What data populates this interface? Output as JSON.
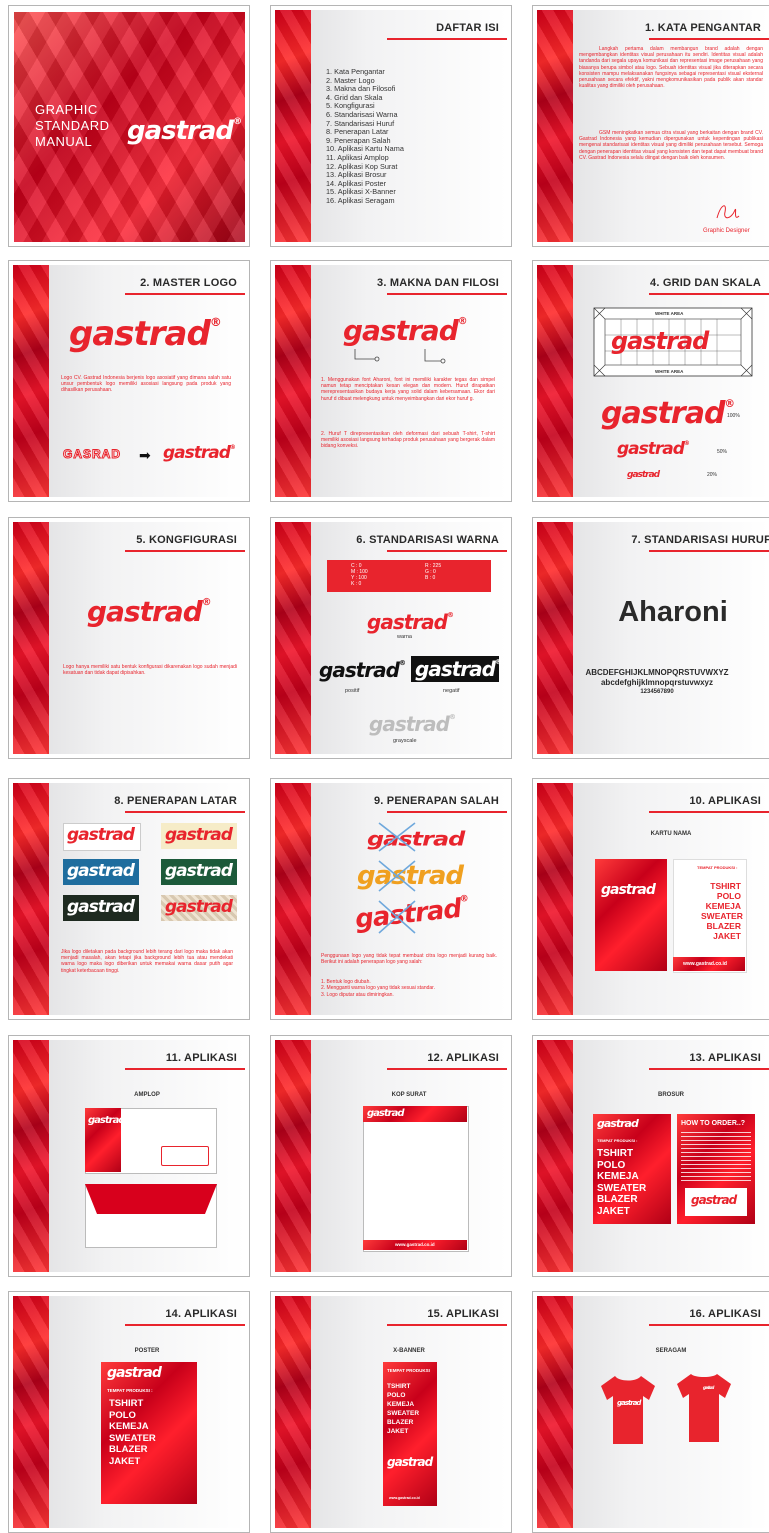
{
  "cover": {
    "line1": "GRAPHIC",
    "line2": "STANDARD",
    "line3": "MANUAL",
    "logo": "gastrad"
  },
  "toc": {
    "title": "DAFTAR ISI",
    "items": [
      "1. Kata Pengantar",
      "2. Master Logo",
      "3. Makna dan Filosofi",
      "4. Grid dan Skala",
      "5. Kongfigurasi",
      "6. Standarisasi Warna",
      "7. Standarisasi Huruf",
      "8. Penerapan Latar",
      "9. Penerapan Salah",
      "10. Aplikasi Kartu Nama",
      "11. Aplikasi Amplop",
      "12. Aplikasi Kop Surat",
      "13. Aplikasi Brosur",
      "14. Aplikasi Poster",
      "15. Aplikasi X-Banner",
      "16. Aplikasi Seragam"
    ]
  },
  "p1": {
    "title": "1. KATA PENGANTAR",
    "para1": "Langkah pertama dalam membangun brand adalah dengan mengembangkan identitas visual perusahaan itu sendiri. Identitas visual adalah tandanda dari segala upaya komunikasi dan representasi image perusahaan yang biasanya berupa simbol atau logo. Sebuah identitas visual jika diterapkan secara konsisten mampu melaksanakan fungsinya sebagai representasi visual eksternal perusahaan secara efektif, yakni mengkomunikasikan pada publik akan standar kualitas yang dimiliki oleh perusahaan.",
    "para2": "GSM meningkatkan semua citra visual yang berkaitan dengan brand CV. Gastrad Indonesia yang kemudian dipergunakan untuk kepentingan publikasi mengenai standarisasi identitas visual yang dimiliki perusahaan tersebut. Semoga dengan penerapan identitas visual yang konsisten dan tepat dapat membuat brand CV. Gastrad Indonesia selalu diingat dengan baik oleh konsumen.",
    "sign": "Graphic Designer"
  },
  "p2": {
    "title": "2. MASTER LOGO",
    "body": "Logo CV. Gastrad Indonesia berjenis logo asosiatif yang dimana salah satu unsur pembentuk logo memiliki asosiasi langsung pada produk yang dihasilkan perusahaan.",
    "old": "GASRAD"
  },
  "p3": {
    "title": "3. MAKNA DAN FILOSI",
    "b1": "1. Menggunakan font Aharoni, font ini memiliki karakter tegas dan simpel namun tetap menciptakan kesan elegan dan modern. Huruf dirapatkan merepresentasikan budaya kerja yang solid dalam kebersamaan. Ekor dari huruf d dibuat melengkung untuk menyeimbangkan dari ekor huruf g.",
    "b2": "2. Huruf T direpresentasikan oleh deformasi dari sebuah T-shirt, T-shirt memiliki asosiasi langsung terhadap produk perusahaan yang bergerak dalam bidang konveksi."
  },
  "p4": {
    "title": "4. GRID DAN SKALA",
    "white": "WHITE AREA",
    "s100": "100%",
    "s50": "50%",
    "s20": "20%"
  },
  "p5": {
    "title": "5. KONGFIGURASI",
    "body": "Logo hanya memiliki satu bentuk konfigurasi dikarenakan logo sudah menjadi kesatuan dan tidak dapat dipisahkan."
  },
  "p6": {
    "title": "6. STANDARISASI WARNA",
    "cmyk": [
      "C : 0",
      "M : 100",
      "Y : 100",
      "K : 0"
    ],
    "rgb": [
      "R : 225",
      "G : 0",
      "B : 0"
    ],
    "warna": "warna",
    "positif": "positif",
    "negatif": "negatif",
    "grayscale": "grayscale"
  },
  "p7": {
    "title": "7. STANDARISASI HURUF",
    "font": "Aharoni",
    "upper": "ABCDEFGHIJKLMNOPQRSTUVWXYZ",
    "lower": "abcdefghijklmnopqrstuvwxyz",
    "digits": "1234567890"
  },
  "p8": {
    "title": "8. PENERAPAN LATAR",
    "body": "Jika logo diletakan pada background lebih terang dari logo maka tidak akan menjadi masalah, akan tetapi jika background lebih tua atau mendekati warna logo maka logo diberikan untuk memakai warna dasar putih agar tingkat keterbacaan tinggi."
  },
  "p9": {
    "title": "9. PENERAPAN SALAH",
    "body": "Penggunaan logo yang tidak tepat membuat citra logo menjadi kurang baik. Berikut ini adalah penerapan logo yang salah:",
    "list": [
      "1. Bentuk logo diubah.",
      "2. Mengganti warna logo yang tidak sesuai standar.",
      "3. Logo diputar atau dimiringkan."
    ]
  },
  "p10": {
    "title": "10. APLIKASI",
    "sub": "KARTU NAMA",
    "head": "TEMPAT PRODUKSI :",
    "items": [
      "TSHIRT",
      "POLO",
      "KEMEJA",
      "SWEATER",
      "BLAZER",
      "JAKET"
    ],
    "web": "www.gastrad.co.id"
  },
  "p11": {
    "title": "11. APLIKASI",
    "sub": "AMPLOP"
  },
  "p12": {
    "title": "12. APLIKASI",
    "sub": "KOP SURAT",
    "web": "www.gastrad.co.id"
  },
  "p13": {
    "title": "13. APLIKASI",
    "sub": "BROSUR",
    "head": "TEMPAT PRODUKSI :",
    "items": [
      "TSHIRT",
      "POLO",
      "KEMEJA",
      "SWEATER",
      "BLAZER",
      "JAKET"
    ],
    "how": "HOW TO ORDER..?"
  },
  "p14": {
    "title": "14. APLIKASI",
    "sub": "POSTER",
    "head": "TEMPAT PRODUKSI :",
    "items": [
      "TSHIRT",
      "POLO",
      "KEMEJA",
      "SWEATER",
      "BLAZER",
      "JAKET"
    ]
  },
  "p15": {
    "title": "15. APLIKASI",
    "sub": "X-BANNER",
    "head": "TEMPAT PRODUKSI",
    "items": [
      "TSHIRT",
      "POLO",
      "KEMEJA",
      "SWEATER",
      "BLAZER",
      "JAKET"
    ],
    "web": "www.gastrad.co.id"
  },
  "p16": {
    "title": "16. APLIKASI",
    "sub": "SERAGAM"
  },
  "colors": {
    "brand_red": "#e8242d",
    "dark": "#2a2a2a"
  }
}
